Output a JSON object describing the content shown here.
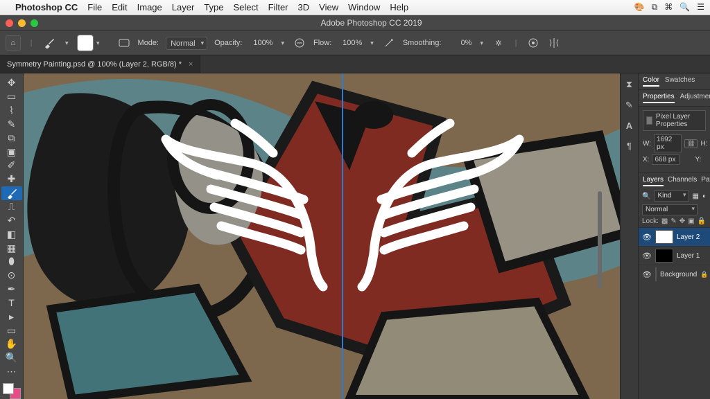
{
  "mac_menu": {
    "apple": "",
    "app": "Photoshop CC",
    "items": [
      "File",
      "Edit",
      "Image",
      "Layer",
      "Type",
      "Select",
      "Filter",
      "3D",
      "View",
      "Window",
      "Help"
    ],
    "right_icons": [
      "siri",
      "control-center",
      "menu-extra",
      "battery",
      "spotlight"
    ]
  },
  "app_title": "Adobe Photoshop CC 2019",
  "document_tab": {
    "title": "Symmetry Painting.psd @ 100% (Layer 2, RGB/8) *"
  },
  "options_bar": {
    "mode_label": "Mode:",
    "mode_value": "Normal",
    "opacity_label": "Opacity:",
    "opacity_value": "100%",
    "flow_label": "Flow:",
    "flow_value": "100%",
    "smoothing_label": "Smoothing:",
    "smoothing_value": "0%"
  },
  "toolbox_tools": [
    "move",
    "rect-marquee",
    "lasso",
    "quick-select",
    "crop",
    "frame",
    "eyedropper",
    "healing",
    "brush",
    "clone",
    "history-brush",
    "eraser",
    "gradient",
    "blur",
    "dodge",
    "pen",
    "type",
    "path-select",
    "rectangle",
    "hand",
    "zoom",
    "3d-tool",
    "edit-toolbar"
  ],
  "right_rail_icons": [
    "history",
    "characters",
    "alignment",
    "85"
  ],
  "panels": {
    "color_tabs": [
      "Color",
      "Swatches"
    ],
    "prop_tabs": [
      "Properties",
      "Adjustment"
    ],
    "pixel_layer_label": "Pixel Layer Properties",
    "W_label": "W:",
    "W_value": "1692 px",
    "H_label": "H:",
    "X_label": "X:",
    "X_value": "668 px",
    "Y_label": "Y:"
  },
  "layers": {
    "tabs": [
      "Layers",
      "Channels",
      "Pat"
    ],
    "kind_label": "Kind",
    "blend_mode": "Normal",
    "lock_label": "Lock:",
    "items": [
      {
        "name": "Layer 2",
        "eye": "👁",
        "selected": true,
        "thumb": "white"
      },
      {
        "name": "Layer 1",
        "eye": "👁",
        "selected": false,
        "thumb": "dark"
      },
      {
        "name": "Background",
        "eye": "👁",
        "selected": false,
        "thumb": "graf",
        "locked": true
      }
    ]
  }
}
